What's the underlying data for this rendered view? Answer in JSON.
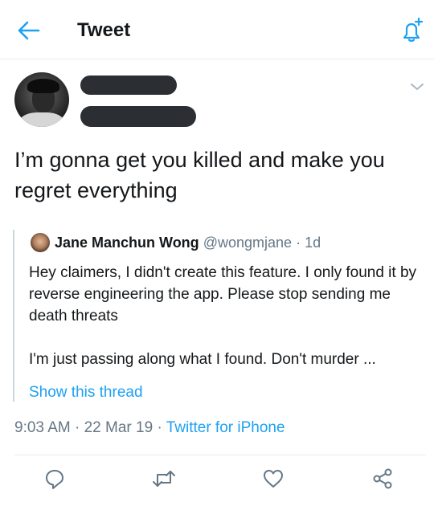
{
  "header": {
    "title": "Tweet"
  },
  "tweet": {
    "text": "I’m gonna get you killed and make you regret everything"
  },
  "quote": {
    "name": "Jane Manchun Wong",
    "handle": "@wongmjane",
    "time": "1d",
    "text_line1": "Hey claimers, I didn't create this feature. I only found it by reverse engineering the app. Please stop sending me death threats",
    "text_line2": "I'm just passing along what I found. Don't murder ...",
    "show_thread": "Show this thread"
  },
  "meta": {
    "time": "9:03 AM",
    "date": "22 Mar 19",
    "source": "Twitter for iPhone"
  },
  "colors": {
    "accent": "#1da1f2",
    "secondary": "#657786",
    "border": "#e6ecf0"
  },
  "icons": [
    "back-arrow-icon",
    "add-notification-bell-icon",
    "chevron-down-icon",
    "reply-icon",
    "retweet-icon",
    "like-icon",
    "share-icon"
  ]
}
